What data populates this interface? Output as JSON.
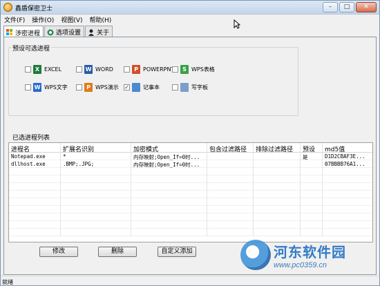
{
  "window": {
    "title": "鑫盾保密卫士"
  },
  "menu": [
    "文件(F)",
    "操作(O)",
    "视图(V)",
    "帮助(H)"
  ],
  "tabs": [
    "涉密进程",
    "选项设置",
    "关于"
  ],
  "preset": {
    "label": "预设可选进程",
    "items": [
      {
        "name": "EXCEL",
        "checked": false,
        "icon_color": "#1e7a3a",
        "icon_letter": "X"
      },
      {
        "name": "WORD",
        "checked": false,
        "icon_color": "#2a5caa",
        "icon_letter": "W"
      },
      {
        "name": "POWERPNT",
        "checked": false,
        "icon_color": "#d0502a",
        "icon_letter": "P"
      },
      {
        "name": "WPS表格",
        "checked": false,
        "icon_color": "#3aa048",
        "icon_letter": "S"
      },
      {
        "name": "WPS文字",
        "checked": false,
        "icon_color": "#2a6ad0",
        "icon_letter": "W"
      },
      {
        "name": "WPS演示",
        "checked": false,
        "icon_color": "#e07a1a",
        "icon_letter": "P"
      },
      {
        "name": "记事本",
        "checked": true,
        "icon_color": "#4a8ad0",
        "icon_letter": ""
      },
      {
        "name": "写字板",
        "checked": false,
        "icon_color": "#7aa0c8",
        "icon_letter": ""
      }
    ]
  },
  "selected": {
    "label": "已选进程列表",
    "columns": [
      "进程名",
      "扩展名识别",
      "加密模式",
      "包含过滤路径",
      "排除过滤路径",
      "预设",
      "md5值"
    ],
    "rows": [
      [
        "Notepad.exe",
        "*",
        "内存映射;Open_If=0时...",
        "",
        "",
        "是",
        "D1D2CBAF3E..."
      ],
      [
        "dllhost.exe",
        ".BMP;.JPG;",
        "内存映射;Open_If=0时...",
        "",
        "",
        "",
        "07BBBB76A1..."
      ]
    ]
  },
  "buttons": {
    "modify": "修改",
    "delete": "删除",
    "custom_add": "自定义添加"
  },
  "status": "就绪",
  "watermark": {
    "name": "河东软件园",
    "url": "www.pc0359.cn"
  }
}
